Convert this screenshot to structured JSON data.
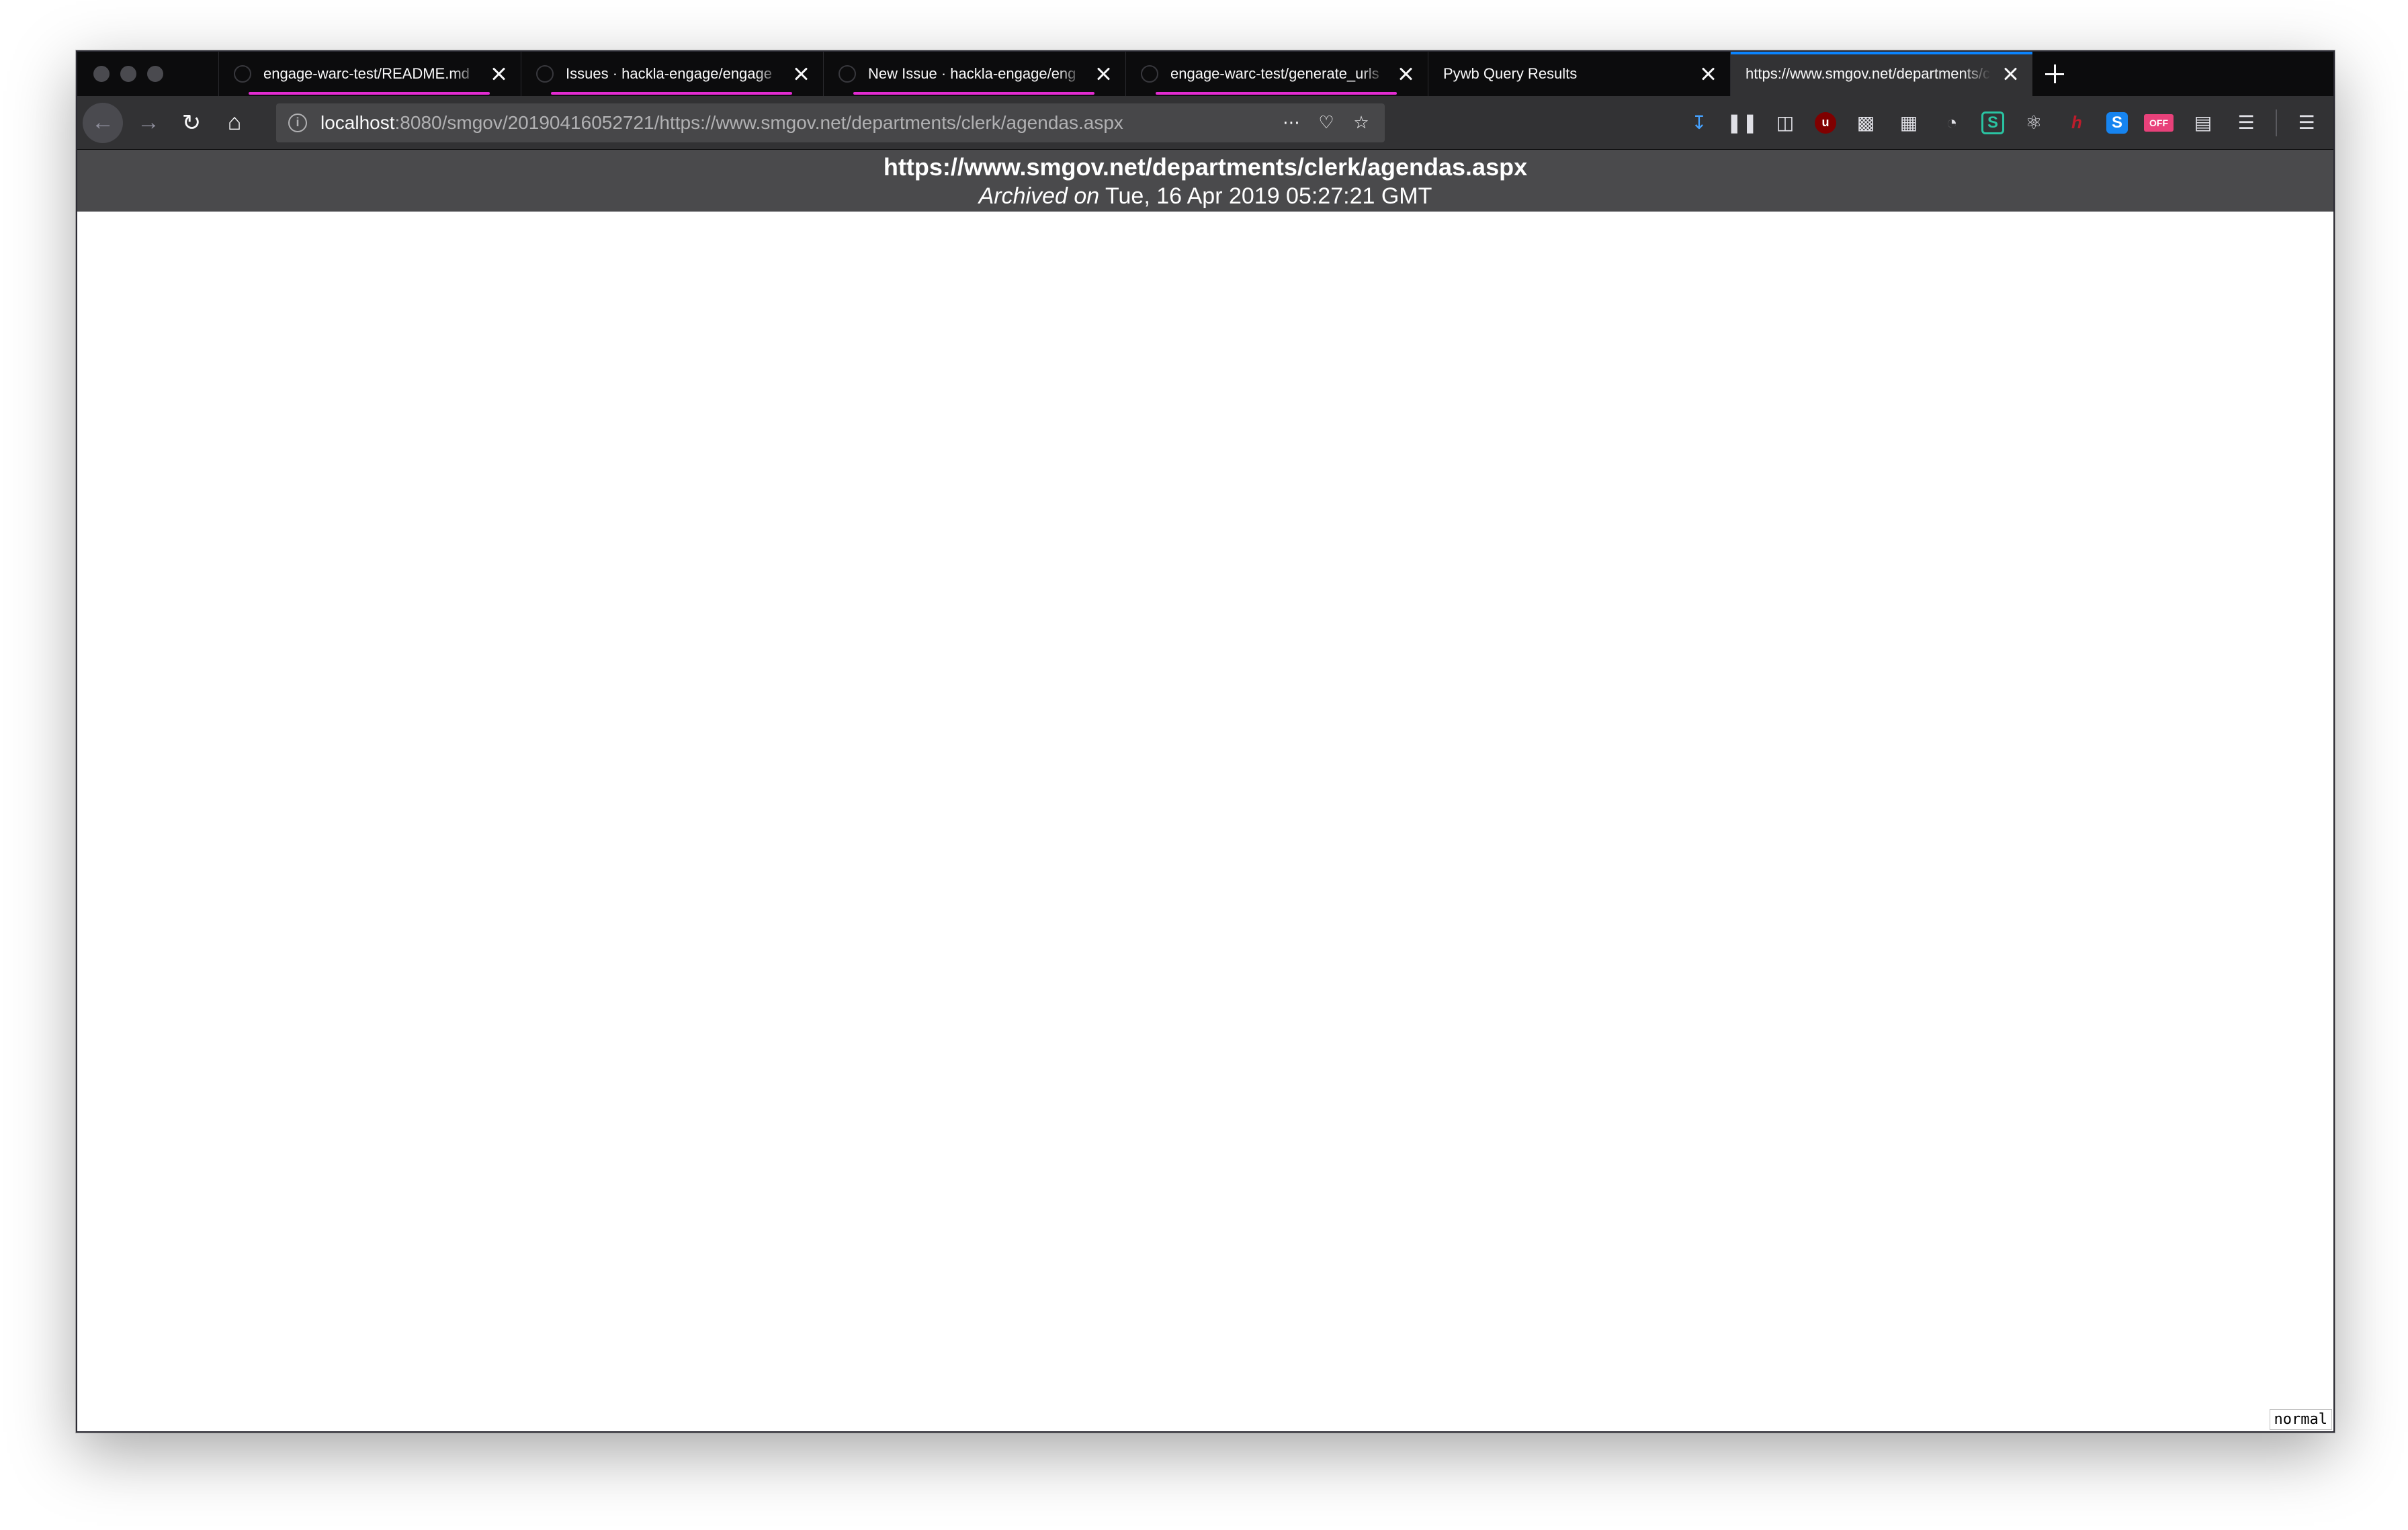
{
  "tabs": [
    {
      "title": "engage-warc-test/README.md",
      "active": false,
      "loading": true
    },
    {
      "title": "Issues · hackla-engage/engage",
      "active": false,
      "loading": true
    },
    {
      "title": "New Issue · hackla-engage/eng",
      "active": false,
      "loading": true
    },
    {
      "title": "engage-warc-test/generate_urls",
      "active": false,
      "loading": true
    },
    {
      "title": "Pywb Query Results",
      "active": false,
      "loading": false
    },
    {
      "title": "https://www.smgov.net/departments/clerk",
      "active": true,
      "loading": false
    }
  ],
  "urlbar": {
    "host": "localhost",
    "rest": ":8080/smgov/20190416052721/https://www.smgov.net/departments/clerk/agendas.aspx"
  },
  "toolbar": {
    "icons": [
      "download-icon",
      "library-icon",
      "sidebar-icon",
      "ublock-icon",
      "screenshot-icon",
      "grid-icon",
      "pie-icon",
      "s-extension-icon",
      "react-devtools-icon",
      "hypothesis-icon",
      "s-blue-extension-icon",
      "off-extension-icon",
      "reader-icon",
      "ruler-icon"
    ],
    "ublock_label": "u",
    "s1_label": "S",
    "hyp_label": "h",
    "s2_label": "S",
    "off_label": "OFF"
  },
  "banner": {
    "url": "https://www.smgov.net/departments/clerk/agendas.aspx",
    "archived_prefix": "Archived on",
    "archived_date": "Tue, 16 Apr 2019 05:27:21 GMT"
  },
  "mode_badge": "normal"
}
